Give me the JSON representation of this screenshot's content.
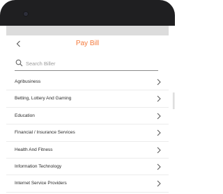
{
  "header": {
    "title": "Pay Bill",
    "back_icon": "chevron-left-icon"
  },
  "search": {
    "placeholder": "Search Biller",
    "value": "",
    "icon": "search-icon"
  },
  "categories": [
    {
      "label": "Agribusiness"
    },
    {
      "label": "Betting, Lottery And Gaming"
    },
    {
      "label": "Education"
    },
    {
      "label": "Financial / Insurance Services"
    },
    {
      "label": "Health And Fitness"
    },
    {
      "label": "Information Technology"
    },
    {
      "label": "Internet Service Providers"
    }
  ],
  "colors": {
    "accent": "#f47a3c",
    "device_frame": "#1f1f21",
    "status_bar": "#dcdcdc"
  }
}
